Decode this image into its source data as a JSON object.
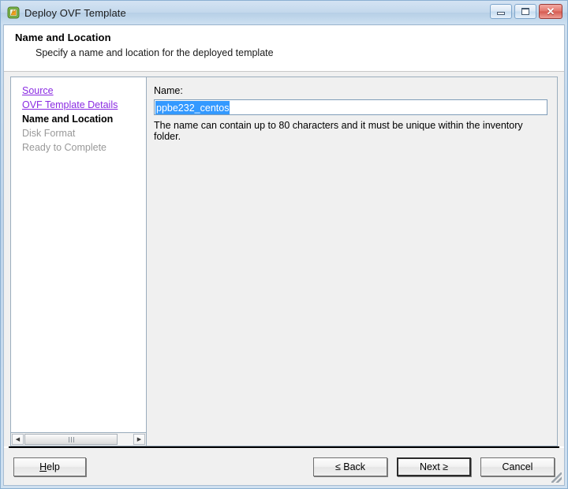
{
  "window": {
    "title": "Deploy OVF Template",
    "icon": "ovf-template-icon",
    "controls": {
      "minimize": "minimize-icon",
      "maximize": "maximize-icon",
      "close": "✕"
    }
  },
  "header": {
    "title": "Name and Location",
    "subtitle": "Specify a name and location for the deployed template"
  },
  "sidebar": {
    "items": [
      {
        "label": "Source",
        "state": "link"
      },
      {
        "label": "OVF Template Details",
        "state": "link"
      },
      {
        "label": "Name and Location",
        "state": "current"
      },
      {
        "label": "Disk Format",
        "state": "disabled"
      },
      {
        "label": "Ready to Complete",
        "state": "disabled"
      }
    ],
    "scrollbar": {
      "left_arrow": "◀",
      "right_arrow": "▶"
    }
  },
  "main": {
    "name_label": "Name:",
    "name_value": "ppbe232_centos",
    "name_placeholder": "",
    "hint": "The name can contain up to 80 characters and it must be unique within the inventory folder."
  },
  "footer": {
    "help": "Help",
    "help_accel": "H",
    "back_prefix": "≤ ",
    "back": "Back",
    "next": "Next ",
    "next_suffix": "≥",
    "cancel": "Cancel"
  },
  "colors": {
    "link": "#8a2be2",
    "selection": "#3399ff",
    "titlebar": "#c3d8ec",
    "panel": "#f0f0f0"
  }
}
